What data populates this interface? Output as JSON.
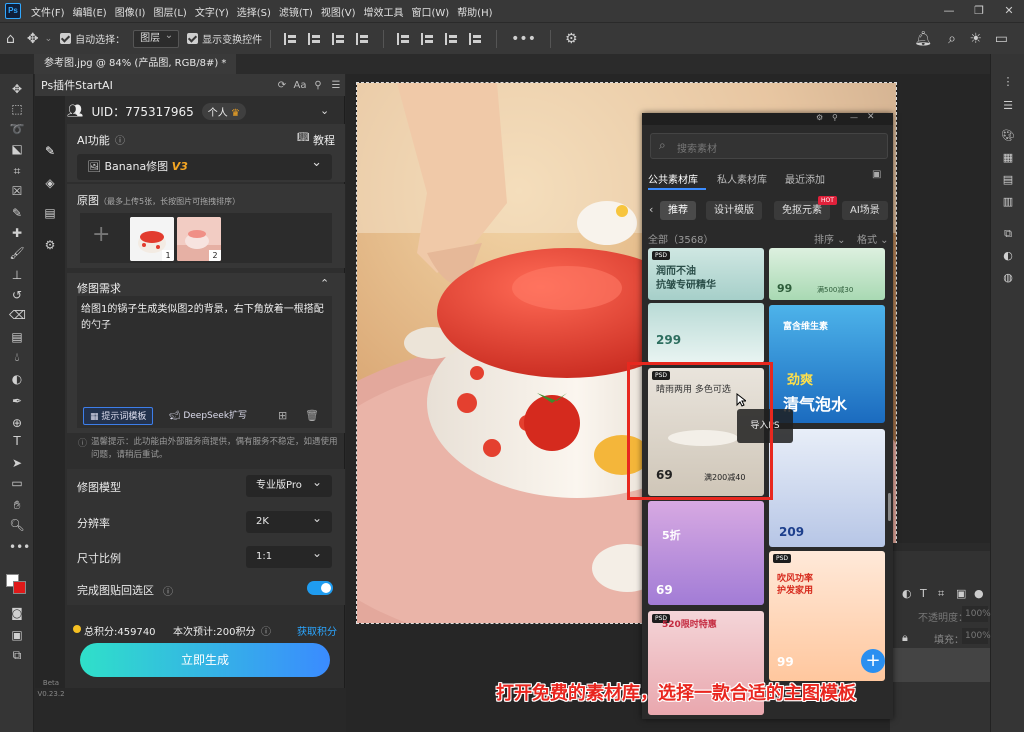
{
  "menubar": {
    "logo": "Ps",
    "items": [
      "文件(F)",
      "编辑(E)",
      "图像(I)",
      "图层(L)",
      "文字(Y)",
      "选择(S)",
      "滤镜(T)",
      "视图(V)",
      "增效工具",
      "窗口(W)",
      "帮助(H)"
    ]
  },
  "options": {
    "auto_select_label": "自动选择：",
    "layer_value": "图层",
    "show_transform_label": "显示变换控件"
  },
  "document": {
    "tab_title": "参考图.jpg @ 84% (产品图, RGB/8#) *"
  },
  "plugin": {
    "title": "Ps插件StartAI",
    "uid": "UID：775317965",
    "account_type": "个人",
    "ai_function_label": "AI功能",
    "tutorial_label": "教程",
    "function_value": "Banana修图",
    "function_version": "V3",
    "original_label": "原图",
    "original_hint": "（最多上传5张，长按图片可拖拽排序）",
    "thumbs": [
      {
        "num": "1"
      },
      {
        "num": "2"
      }
    ],
    "requirement_label": "修图需求",
    "requirement_text": "给图1的锅子生成类似图2的背景，右下角放着一根搭配的勺子",
    "prompt_template_btn": "提示词模板",
    "deepseek_btn": "DeepSeek扩写",
    "tip_text": "温馨提示：此功能由外部服务商提供，偶有服务不稳定，如遇使用问题，请稍后重试。",
    "model_label": "修图模型",
    "model_value": "专业版Pro",
    "resolution_label": "分辨率",
    "resolution_value": "2K",
    "ratio_label": "尺寸比例",
    "ratio_value": "1:1",
    "paste_back_label": "完成图贴回选区",
    "paste_back_on": true,
    "points_text": "总积分:459740",
    "estimate_text": "本次预计:200积分",
    "get_points": "获取积分",
    "generate_btn": "立即生成",
    "beta_label": "Beta",
    "version": "V0.23.2"
  },
  "library": {
    "search_placeholder": "搜索素材",
    "tabs": [
      "公共素材库",
      "私人素材库",
      "最近添加"
    ],
    "chips": [
      "推荐",
      "设计模版",
      "免抠元素",
      "AI场景"
    ],
    "hot_badge": "HOT",
    "count_label": "全部（3568）",
    "sort_label": "排序",
    "format_label": "格式",
    "psd_badge": "PSD",
    "cards": {
      "c1_title": "润而不油",
      "c1_sub": "抗皱专研精华",
      "c1_price": "299",
      "c2_price": "99",
      "c2_note": "满500减30",
      "c3_title": "晴雨两用 多色可选",
      "c3_price": "69",
      "c3_note": "满200减40",
      "c4_title": "富含维生素",
      "c4_big": "劲爽",
      "c4_big2": "清气泡水",
      "c5_price": "209",
      "c6_price": "69",
      "c6_title": "5折",
      "c7_title": "吹风功率",
      "c7_sub": "护发家用",
      "c7_price": "99",
      "c8_title": "520限时特惠"
    },
    "import_tip": "导入PS",
    "add_btn": "+"
  },
  "layers": {
    "opacity_label": "不透明度：",
    "opacity_value": "100%",
    "fill_label": "填充：",
    "fill_value": "100%"
  },
  "caption": "打开免费的素材库，选择一款合适的主图模板",
  "colors": {
    "accent": "#2ba6ff",
    "highlight": "#e8281f",
    "generate_start": "#2fe0c9",
    "generate_end": "#3a8bff",
    "foreground": "#ffffff",
    "background": "#e01919"
  }
}
